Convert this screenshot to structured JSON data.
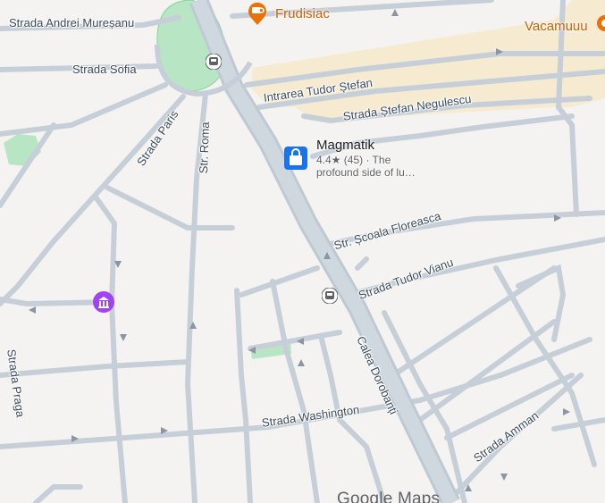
{
  "map": {
    "streets": {
      "andrei_muresanu": "Strada Andrei Mureșanu",
      "sofia": "Strada Sofia",
      "paris": "Strada Paris",
      "roma": "Str. Roma",
      "intrarea_tudor_stefan": "Intrarea Tudor Ștefan",
      "stefan_negulescu": "Strada Ștefan Negulescu",
      "scoala_floreasca": "Str. Școala Floreasca",
      "tudor_vianu": "Strada Tudor Vianu",
      "calea_dorobanti": "Calea Dorobanți",
      "washington": "Strada Washington",
      "praga": "Strada Praga",
      "amman": "Strada Amman"
    },
    "places": {
      "frudisiac": {
        "name": "Frudisiac",
        "icon": "coffee-icon"
      },
      "vacamuuu": {
        "name": "Vacamuuu",
        "icon": "restaurant-icon"
      },
      "magmatik": {
        "name": "Magmatik",
        "rating_line": "4.4★ (45) · The",
        "description_line": "profound side of lu…",
        "icon": "shopping-bag-icon"
      },
      "museum": {
        "icon": "museum-icon"
      }
    },
    "transit": {
      "icon": "bus-stop-icon"
    },
    "logo": "Google Maps",
    "colors": {
      "background": "#f4f3f1",
      "road": "#c6cfd8",
      "main_road": "#bfc9d2",
      "park": "#b8e6c4",
      "park_border": "#86d39d",
      "commercial": "#f6ebd0",
      "label": "#3c4a5c",
      "orange_poi": "#e8710a",
      "blue_poi": "#1a73e8",
      "purple_poi": "#a142f4"
    }
  }
}
